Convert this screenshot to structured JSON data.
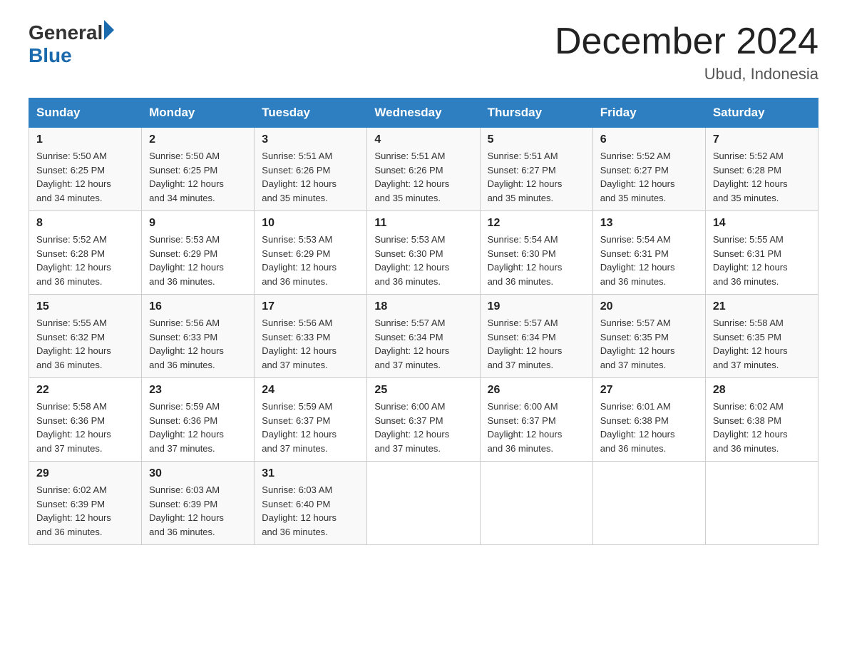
{
  "header": {
    "logo_general": "General",
    "logo_blue": "Blue",
    "month_title": "December 2024",
    "location": "Ubud, Indonesia"
  },
  "days_of_week": [
    "Sunday",
    "Monday",
    "Tuesday",
    "Wednesday",
    "Thursday",
    "Friday",
    "Saturday"
  ],
  "weeks": [
    [
      {
        "day": "1",
        "sunrise": "5:50 AM",
        "sunset": "6:25 PM",
        "daylight": "12 hours and 34 minutes."
      },
      {
        "day": "2",
        "sunrise": "5:50 AM",
        "sunset": "6:25 PM",
        "daylight": "12 hours and 34 minutes."
      },
      {
        "day": "3",
        "sunrise": "5:51 AM",
        "sunset": "6:26 PM",
        "daylight": "12 hours and 35 minutes."
      },
      {
        "day": "4",
        "sunrise": "5:51 AM",
        "sunset": "6:26 PM",
        "daylight": "12 hours and 35 minutes."
      },
      {
        "day": "5",
        "sunrise": "5:51 AM",
        "sunset": "6:27 PM",
        "daylight": "12 hours and 35 minutes."
      },
      {
        "day": "6",
        "sunrise": "5:52 AM",
        "sunset": "6:27 PM",
        "daylight": "12 hours and 35 minutes."
      },
      {
        "day": "7",
        "sunrise": "5:52 AM",
        "sunset": "6:28 PM",
        "daylight": "12 hours and 35 minutes."
      }
    ],
    [
      {
        "day": "8",
        "sunrise": "5:52 AM",
        "sunset": "6:28 PM",
        "daylight": "12 hours and 36 minutes."
      },
      {
        "day": "9",
        "sunrise": "5:53 AM",
        "sunset": "6:29 PM",
        "daylight": "12 hours and 36 minutes."
      },
      {
        "day": "10",
        "sunrise": "5:53 AM",
        "sunset": "6:29 PM",
        "daylight": "12 hours and 36 minutes."
      },
      {
        "day": "11",
        "sunrise": "5:53 AM",
        "sunset": "6:30 PM",
        "daylight": "12 hours and 36 minutes."
      },
      {
        "day": "12",
        "sunrise": "5:54 AM",
        "sunset": "6:30 PM",
        "daylight": "12 hours and 36 minutes."
      },
      {
        "day": "13",
        "sunrise": "5:54 AM",
        "sunset": "6:31 PM",
        "daylight": "12 hours and 36 minutes."
      },
      {
        "day": "14",
        "sunrise": "5:55 AM",
        "sunset": "6:31 PM",
        "daylight": "12 hours and 36 minutes."
      }
    ],
    [
      {
        "day": "15",
        "sunrise": "5:55 AM",
        "sunset": "6:32 PM",
        "daylight": "12 hours and 36 minutes."
      },
      {
        "day": "16",
        "sunrise": "5:56 AM",
        "sunset": "6:33 PM",
        "daylight": "12 hours and 36 minutes."
      },
      {
        "day": "17",
        "sunrise": "5:56 AM",
        "sunset": "6:33 PM",
        "daylight": "12 hours and 37 minutes."
      },
      {
        "day": "18",
        "sunrise": "5:57 AM",
        "sunset": "6:34 PM",
        "daylight": "12 hours and 37 minutes."
      },
      {
        "day": "19",
        "sunrise": "5:57 AM",
        "sunset": "6:34 PM",
        "daylight": "12 hours and 37 minutes."
      },
      {
        "day": "20",
        "sunrise": "5:57 AM",
        "sunset": "6:35 PM",
        "daylight": "12 hours and 37 minutes."
      },
      {
        "day": "21",
        "sunrise": "5:58 AM",
        "sunset": "6:35 PM",
        "daylight": "12 hours and 37 minutes."
      }
    ],
    [
      {
        "day": "22",
        "sunrise": "5:58 AM",
        "sunset": "6:36 PM",
        "daylight": "12 hours and 37 minutes."
      },
      {
        "day": "23",
        "sunrise": "5:59 AM",
        "sunset": "6:36 PM",
        "daylight": "12 hours and 37 minutes."
      },
      {
        "day": "24",
        "sunrise": "5:59 AM",
        "sunset": "6:37 PM",
        "daylight": "12 hours and 37 minutes."
      },
      {
        "day": "25",
        "sunrise": "6:00 AM",
        "sunset": "6:37 PM",
        "daylight": "12 hours and 37 minutes."
      },
      {
        "day": "26",
        "sunrise": "6:00 AM",
        "sunset": "6:37 PM",
        "daylight": "12 hours and 36 minutes."
      },
      {
        "day": "27",
        "sunrise": "6:01 AM",
        "sunset": "6:38 PM",
        "daylight": "12 hours and 36 minutes."
      },
      {
        "day": "28",
        "sunrise": "6:02 AM",
        "sunset": "6:38 PM",
        "daylight": "12 hours and 36 minutes."
      }
    ],
    [
      {
        "day": "29",
        "sunrise": "6:02 AM",
        "sunset": "6:39 PM",
        "daylight": "12 hours and 36 minutes."
      },
      {
        "day": "30",
        "sunrise": "6:03 AM",
        "sunset": "6:39 PM",
        "daylight": "12 hours and 36 minutes."
      },
      {
        "day": "31",
        "sunrise": "6:03 AM",
        "sunset": "6:40 PM",
        "daylight": "12 hours and 36 minutes."
      },
      null,
      null,
      null,
      null
    ]
  ],
  "labels": {
    "sunrise": "Sunrise:",
    "sunset": "Sunset:",
    "daylight": "Daylight:"
  }
}
